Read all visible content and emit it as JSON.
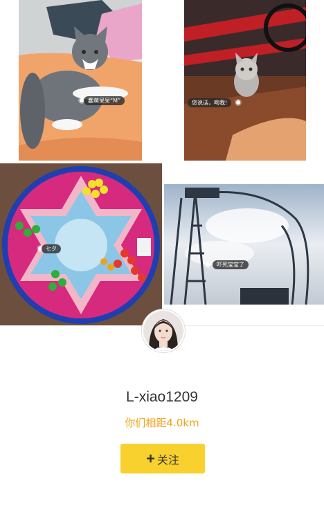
{
  "photos": [
    {
      "tag": "蠢萌呆呆“M”"
    },
    {
      "tag": "您说话，吻我!"
    },
    {
      "tag": "七夕"
    },
    {
      "tag": "吓死宝宝了"
    }
  ],
  "profile": {
    "username": "L-xiao1209",
    "distance": "你们相距4.0km",
    "follow_label": "关注",
    "follow_icon": "+"
  },
  "colors": {
    "distance": "#f0a21a",
    "follow_button": "#f8d12f"
  }
}
